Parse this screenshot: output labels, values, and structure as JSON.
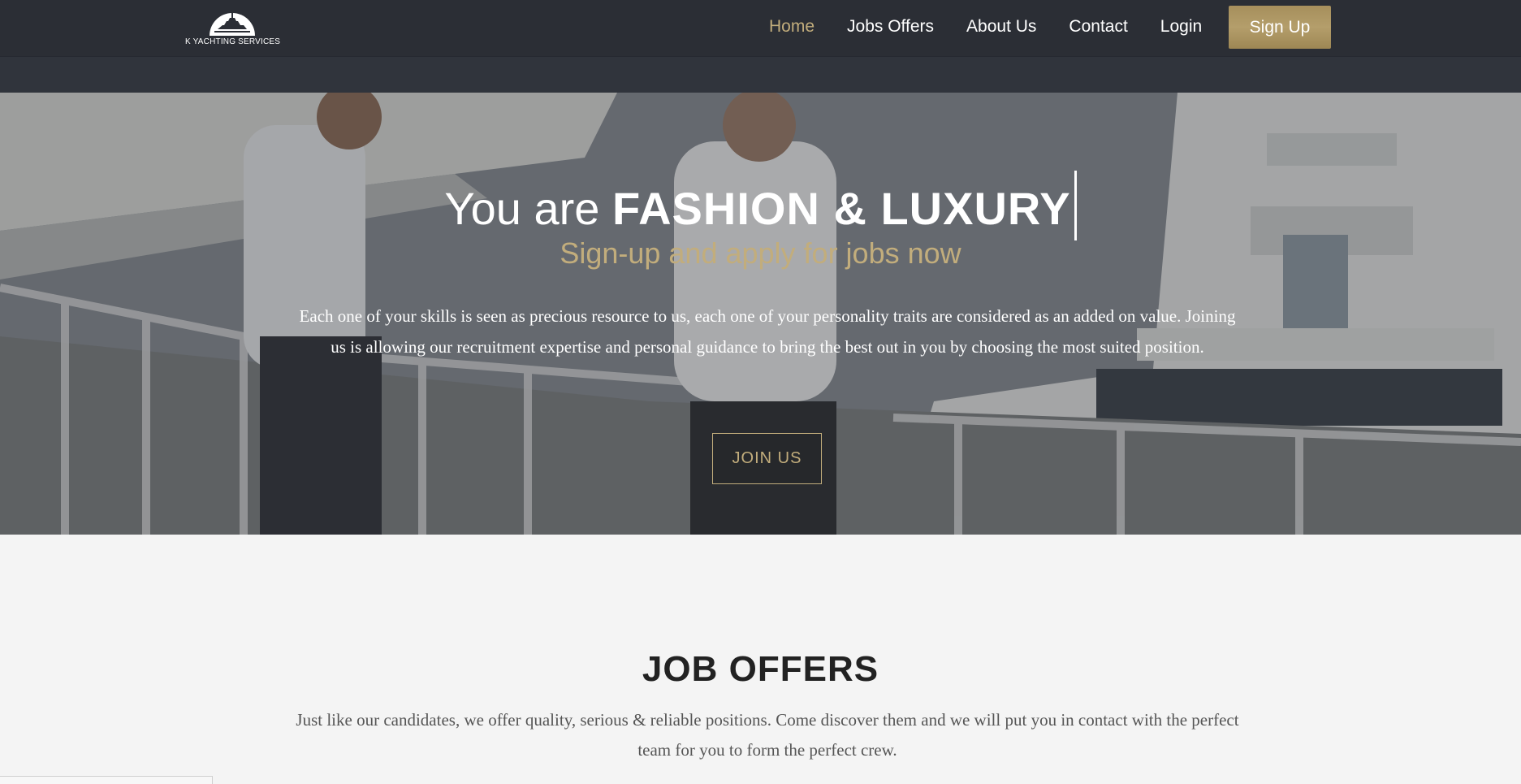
{
  "nav": {
    "logo_text": "K YACHTING SERVICES",
    "links": [
      {
        "label": "Home",
        "active": true
      },
      {
        "label": "Jobs Offers",
        "active": false
      },
      {
        "label": "About Us",
        "active": false
      },
      {
        "label": "Contact",
        "active": false
      },
      {
        "label": "Login",
        "active": false
      }
    ],
    "signup_label": "Sign Up"
  },
  "hero": {
    "title_prefix": "You are",
    "title_highlight": "FASHION & LUXURY",
    "subtitle": "Sign-up and apply for jobs now",
    "description": "Each one of your skills is seen as precious resource to us, each one of your personality traits are considered as an added on value. Joining us is allowing our recruitment expertise and personal guidance to bring the best out in you by choosing the most suited position.",
    "join_label": "JOIN US"
  },
  "offers": {
    "title": "JOB OFFERS",
    "description": "Just like our candidates, we offer quality, serious & reliable positions. Come discover them and we will put you in contact with the perfect team for you to form the perfect crew."
  },
  "colors": {
    "nav_bg": "#2b2e35",
    "accent_gold": "#c2ad7c",
    "signup_gold": "#a68f5c",
    "section_bg": "#f4f4f4"
  }
}
